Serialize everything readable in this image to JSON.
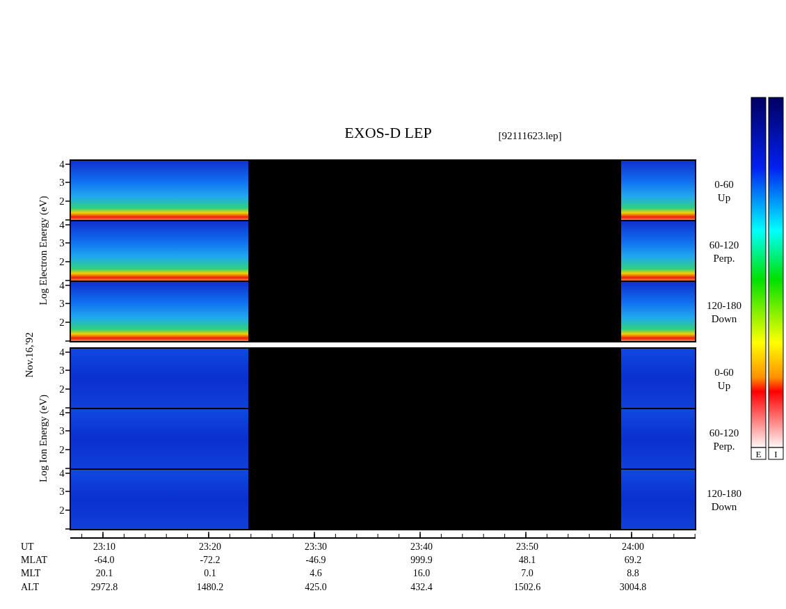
{
  "title": "EXOS-D LEP",
  "file_name": "[92111623.lep]",
  "date": "Nov.16,'92",
  "species": [
    {
      "kind": "electron",
      "axis_label": "Log Electron Energy (eV)",
      "panels": [
        {
          "angle": "0-60",
          "direction": "Up",
          "yticks": [
            "4",
            "3",
            "2"
          ]
        },
        {
          "angle": "60-120",
          "direction": "Perp.",
          "yticks": [
            "4",
            "3",
            "2"
          ]
        },
        {
          "angle": "120-180",
          "direction": "Down",
          "yticks": [
            "4",
            "3",
            "2"
          ]
        }
      ]
    },
    {
      "kind": "ion",
      "axis_label": "Log Ion Energy (eV)",
      "panels": [
        {
          "angle": "0-60",
          "direction": "Up",
          "yticks": [
            "4",
            "3",
            "2"
          ]
        },
        {
          "angle": "60-120",
          "direction": "Perp.",
          "yticks": [
            "4",
            "3",
            "2"
          ]
        },
        {
          "angle": "120-180",
          "direction": "Down",
          "yticks": [
            "4",
            "3",
            "2"
          ]
        }
      ]
    }
  ],
  "time_axis": [
    {
      "label": "UT",
      "values": [
        "23:10",
        "23:20",
        "23:30",
        "23:40",
        "23:50",
        "24:00"
      ]
    },
    {
      "label": "MLAT",
      "values": [
        "-64.0",
        "-72.2",
        "-46.9",
        "999.9",
        "48.1",
        "69.2"
      ]
    },
    {
      "label": "MLT",
      "values": [
        "20.1",
        "0.1",
        "4.6",
        "16.0",
        "7.0",
        "8.8"
      ]
    },
    {
      "label": "ALT",
      "values": [
        "2972.8",
        "1480.2",
        "425.0",
        "432.4",
        "1502.6",
        "3004.8"
      ]
    }
  ],
  "color_bars": [
    {
      "label": "E"
    },
    {
      "label": "I"
    }
  ]
}
